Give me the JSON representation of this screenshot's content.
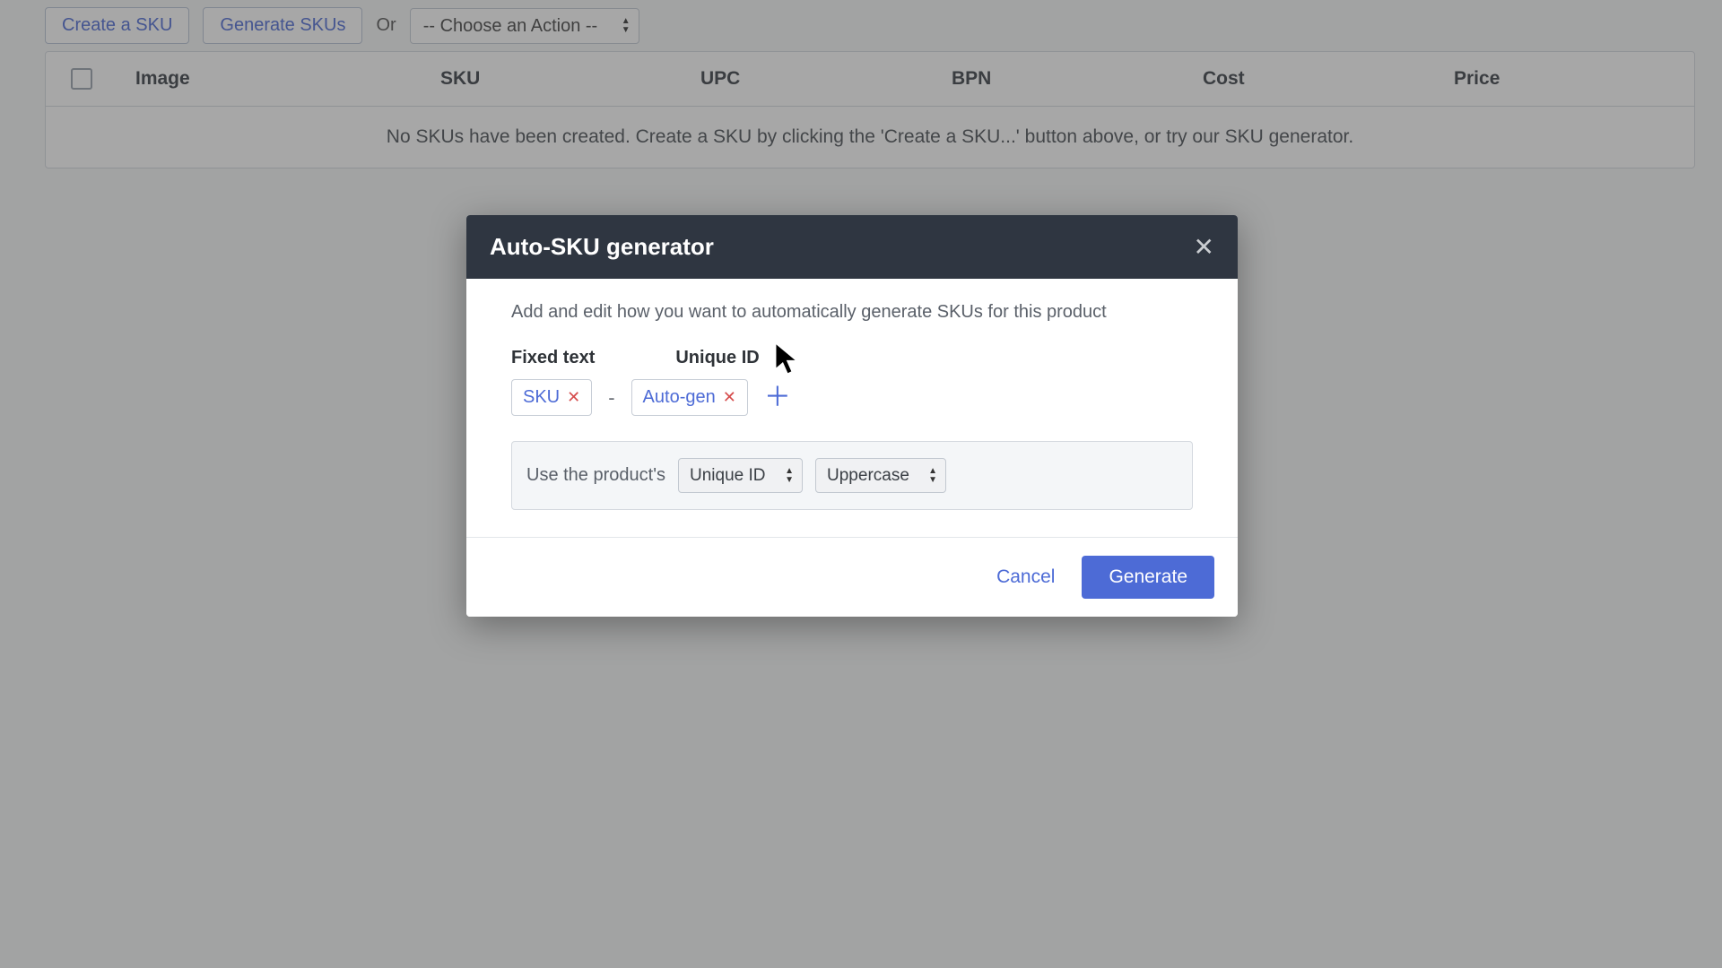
{
  "toolbar": {
    "create_label": "Create a SKU",
    "generate_label": "Generate SKUs",
    "or_label": "Or",
    "action_placeholder": "-- Choose an Action --"
  },
  "table": {
    "headers": {
      "image": "Image",
      "sku": "SKU",
      "upc": "UPC",
      "bpn": "BPN",
      "cost": "Cost",
      "price": "Price"
    },
    "empty_message": "No SKUs have been created. Create a SKU by clicking the 'Create a SKU...' button above, or try our SKU generator."
  },
  "modal": {
    "title": "Auto-SKU generator",
    "description": "Add and edit how you want to automatically generate SKUs for this product",
    "labels": {
      "fixed_text": "Fixed text",
      "unique_id": "Unique ID"
    },
    "tokens": [
      {
        "text": "SKU"
      },
      {
        "text": "Auto-gen"
      }
    ],
    "separator": "-",
    "config": {
      "prefix_text": "Use the product's",
      "source_select": "Unique ID",
      "case_select": "Uppercase"
    },
    "footer": {
      "cancel": "Cancel",
      "generate": "Generate"
    }
  }
}
